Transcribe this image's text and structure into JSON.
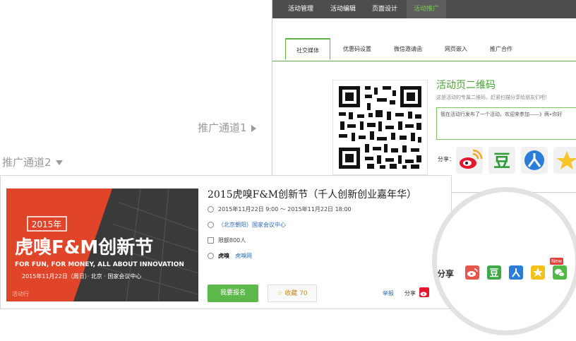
{
  "channel1": {
    "label": "推广通道1"
  },
  "channel2": {
    "label": "推广通道2"
  },
  "admin_nav": {
    "items": [
      "活动管理",
      "活动编辑",
      "页面设计",
      "活动推广"
    ],
    "active_index": 3
  },
  "promo_tabs": {
    "items": [
      "社交媒体",
      "优惠码设置",
      "微信邀请函",
      "网页嵌入",
      "推广合作"
    ],
    "active_index": 0
  },
  "qr_section": {
    "title": "活动页二维码",
    "description": "这是活动的专属二维码，赶紧扫描分享给朋友们吧！",
    "share_text": "我在活动行发布了一个活动，欢迎来参加——》两∙你好",
    "share_label": "分享："
  },
  "share_icons": [
    "weibo-icon",
    "douban-icon",
    "renren-icon",
    "qzone-icon"
  ],
  "event": {
    "title": "2015虎嗅F&M创新节（千人创新创业嘉年华）",
    "datetime": "2015年11月22日 9:00 ～ 2015年11月22日 18:00",
    "location": "（北京朝阳）国家会议中心",
    "capacity": "限额800人",
    "organizer_logo": "虎嗅",
    "organizer": "虎嗅网",
    "register_button": "我要报名",
    "favorite_label": "收藏",
    "favorite_count": "70",
    "report_link": "举报",
    "share_label": "分享"
  },
  "banner": {
    "year": "2015年",
    "brand": "虎嗅F&M创新节",
    "slogan": "FOR FUN, FOR MONEY, ALL ABOUT INNOVATION",
    "date_location": "2015年11月22日（周日）· 北京 · 国家会议中心",
    "watermark": "活动行"
  },
  "magnifier": {
    "share_label": "分享",
    "new_badge": "New",
    "icons": [
      "weibo-icon",
      "douban-icon",
      "renren-icon",
      "qzone-icon",
      "wechat-icon"
    ]
  },
  "colors": {
    "accent_green": "#5cb84a",
    "nav_dark": "#4d4d4d",
    "banner_red": "#e0452a",
    "link_blue": "#2a6ab3"
  }
}
